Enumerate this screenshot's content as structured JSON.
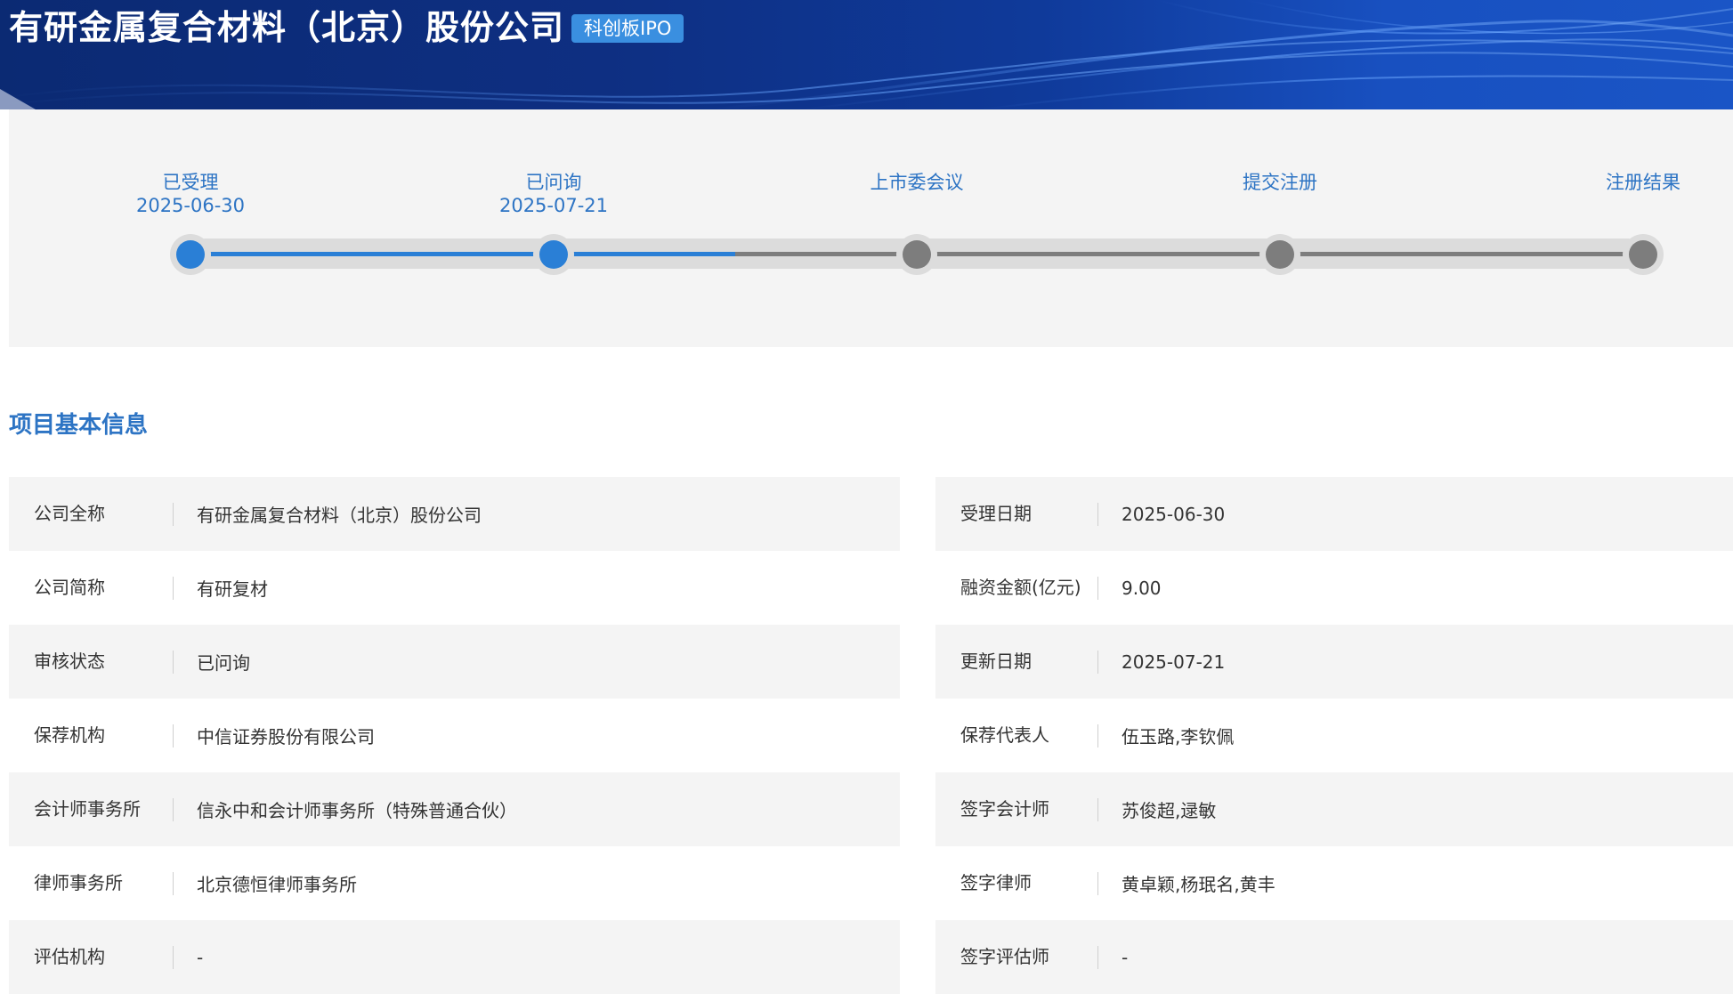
{
  "header": {
    "company_title": "有研金属复合材料（北京）股份公司",
    "board_badge": "科创板IPO"
  },
  "progress": {
    "steps": [
      {
        "label": "已受理",
        "date": "2025-06-30",
        "status": "done"
      },
      {
        "label": "已问询",
        "date": "2025-07-21",
        "status": "done"
      },
      {
        "label": "上市委会议",
        "date": "",
        "status": "pending"
      },
      {
        "label": "提交注册",
        "date": "",
        "status": "pending"
      },
      {
        "label": "注册结果",
        "date": "",
        "status": "pending"
      }
    ],
    "filled_fraction": 0.375
  },
  "section": {
    "title": "项目基本信息"
  },
  "info_left": [
    {
      "key": "公司全称",
      "value": "有研金属复合材料（北京）股份公司"
    },
    {
      "key": "公司简称",
      "value": "有研复材"
    },
    {
      "key": "审核状态",
      "value": "已问询"
    },
    {
      "key": "保荐机构",
      "value": "中信证券股份有限公司"
    },
    {
      "key": "会计师事务所",
      "value": "信永中和会计师事务所（特殊普通合伙）"
    },
    {
      "key": "律师事务所",
      "value": "北京德恒律师事务所"
    },
    {
      "key": "评估机构",
      "value": "-"
    }
  ],
  "info_right": [
    {
      "key": "受理日期",
      "value": "2025-06-30"
    },
    {
      "key": "融资金额(亿元)",
      "value": "9.00"
    },
    {
      "key": "更新日期",
      "value": "2025-07-21"
    },
    {
      "key": "保荐代表人",
      "value": "伍玉路,李钦佩"
    },
    {
      "key": "签字会计师",
      "value": "苏俊超,逯敏"
    },
    {
      "key": "签字律师",
      "value": "黄卓颖,杨珉名,黄丰"
    },
    {
      "key": "签字评估师",
      "value": "-"
    }
  ],
  "colors": {
    "banner_dark": "#0b2a73",
    "accent_blue": "#2a7fd6",
    "label_blue": "#2d74c4",
    "badge_blue": "#3a8fe0",
    "pending_gray": "#7d7d7d",
    "row_shade": "#f4f4f4"
  }
}
